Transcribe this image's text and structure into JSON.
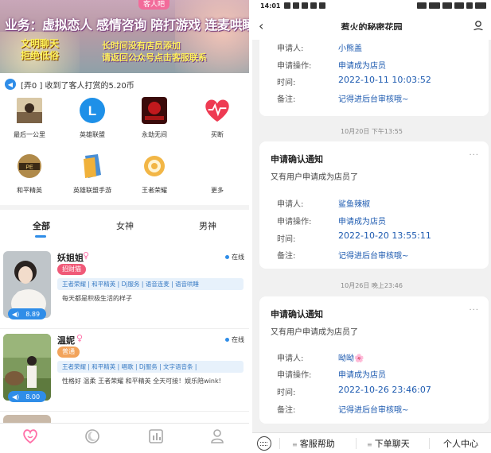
{
  "banner": {
    "tag": "客人吧",
    "headline": "业务：虚拟恋人 感情咨询 陪打游戏 连麦哄睡",
    "sub1_line1": "文明聊天",
    "sub1_line2": "拒绝低俗",
    "sub2_line1": "长时间没有店员添加",
    "sub2_line2": "请返回公众号点击客服联系"
  },
  "notice": {
    "text": "[弄0 ] 收到了客人打赏的5.20币"
  },
  "grid": [
    {
      "label": "最后一公里",
      "icon": "photo-icon"
    },
    {
      "label": "英雄联盟",
      "icon": "lol-icon"
    },
    {
      "label": "永劫无间",
      "icon": "naraka-icon"
    },
    {
      "label": "买断",
      "icon": "heart-icon"
    },
    {
      "label": "和平精英",
      "icon": "peace-elite-icon"
    },
    {
      "label": "英雄联盟手游",
      "icon": "lol-mobile-icon"
    },
    {
      "label": "王者荣耀",
      "icon": "honor-of-kings-icon"
    },
    {
      "label": "更多",
      "icon": "more-icon"
    }
  ],
  "tabs": [
    "全部",
    "女神",
    "男神"
  ],
  "cards": [
    {
      "name": "妖姐姐",
      "gender": "♀",
      "online": "在线",
      "badge": "招财猫",
      "badge_color": "#f05a78",
      "skills": "王者荣耀 | 和平精英 | Dj服务 | 语音连麦 | 语音哄睡",
      "desc": "每天都是积极生活的样子",
      "duration": "8.89"
    },
    {
      "name": "温妮",
      "gender": "♀",
      "online": "在线",
      "badge": "普通",
      "badge_color": "#f2a35a",
      "skills": "王者荣耀 | 和平精英 | 唱歌 | Dj服务 | 文字语音条 |",
      "desc": "性格好 温柔 王者荣耀 和平精英 全天可接！娱乐陪wink!",
      "duration": "8.00"
    }
  ],
  "bottom_nav": [
    "首页推荐",
    "动态广场",
    "店员订单",
    "个人中心"
  ],
  "status": {
    "time": "14:01"
  },
  "chat": {
    "title": "惹火的秘密花园",
    "messages": [
      {
        "partial": true,
        "applicant_label": "申请人:",
        "applicant": "小熊盖",
        "op_label": "申请操作:",
        "op": "申请成为店员",
        "time_label": "时间:",
        "time": "2022-10-11 10:03:52",
        "note_label": "备注:",
        "note": "记得进后台审核哦~"
      },
      {
        "stamp": "10月20日 下午13:55",
        "title": "申请确认通知",
        "subtitle": "又有用户申请成为店员了",
        "applicant_label": "申请人:",
        "applicant": "鲨鱼辣椒",
        "op_label": "申请操作:",
        "op": "申请成为店员",
        "time_label": "时间:",
        "time": "2022-10-20 13:55:11",
        "note_label": "备注:",
        "note": "记得进后台审核哦~"
      },
      {
        "stamp": "10月26日 晚上23:46",
        "title": "申请确认通知",
        "subtitle": "又有用户申请成为店员了",
        "applicant_label": "申请人:",
        "applicant": "呦呦🌸",
        "op_label": "申请操作:",
        "op": "申请成为店员",
        "time_label": "时间:",
        "time": "2022-10-26 23:46:07",
        "note_label": "备注:",
        "note": "记得进后台审核哦~"
      }
    ],
    "more": "···"
  },
  "chat_bottom": [
    "客服帮助",
    "下单聊天",
    "个人中心"
  ],
  "colors": {
    "accent": "#2f8de8",
    "link": "#1e5bb0",
    "pink": "#ff6fa7"
  }
}
